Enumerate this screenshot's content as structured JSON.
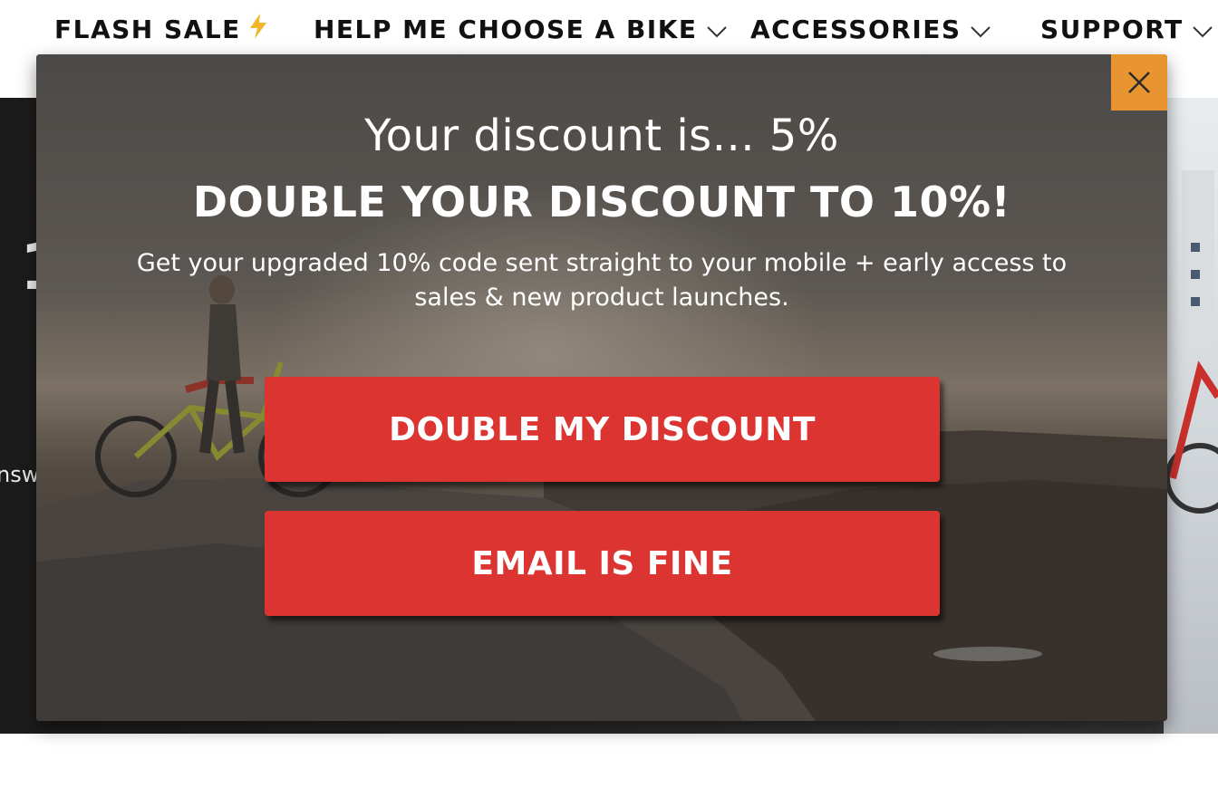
{
  "nav": {
    "items": [
      {
        "label": "FLASH SALE",
        "icon": "lightning-icon"
      },
      {
        "label": "HELP ME CHOOSE A BIKE",
        "icon": "chevron-down-icon"
      },
      {
        "label": "ACCESSORIES",
        "icon": "chevron-down-icon"
      },
      {
        "label": "SUPPORT",
        "icon": "chevron-down-icon"
      }
    ]
  },
  "hero": {
    "partial_heading": "1",
    "partial_text": "nsw"
  },
  "modal": {
    "subheadline": "Your discount is... 5%",
    "headline": "DOUBLE YOUR DISCOUNT TO 10%!",
    "body": "Get your upgraded 10% code sent straight to your mobile + early access to sales & new product launches.",
    "primary_button": "DOUBLE MY DISCOUNT",
    "secondary_button": "EMAIL IS FINE",
    "close_icon": "close-icon"
  },
  "colors": {
    "accent_orange": "#e89431",
    "cta_red": "#dc3531",
    "bolt_yellow": "#f2b629"
  }
}
